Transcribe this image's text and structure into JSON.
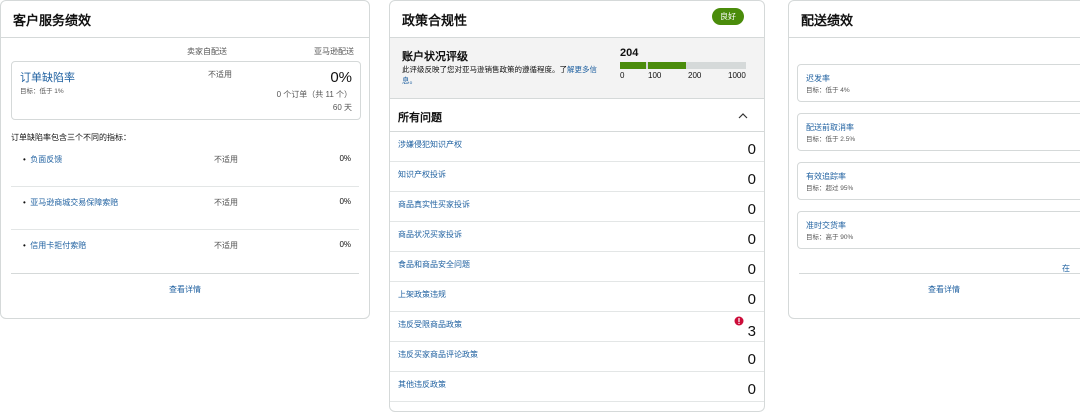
{
  "customer": {
    "title": "客户服务绩效",
    "col_seller": "卖家自配送",
    "col_amazon": "亚马逊配送",
    "odr_label": "订单缺陷率",
    "odr_target": "目标：低于 1%",
    "odr_seller": "不适用",
    "odr_amazon": "0%",
    "odr_orders": "0 个订单（共 11 个）",
    "odr_days": "60 天",
    "intro": "订单缺陷率包含三个不同的指标：",
    "metrics": [
      {
        "label": "负面反馈",
        "seller": "不适用",
        "amazon": "0%"
      },
      {
        "label": "亚马逊商城交易保障索赔",
        "seller": "不适用",
        "amazon": "0%"
      },
      {
        "label": "信用卡拒付索赔",
        "seller": "不适用",
        "amazon": "0%"
      }
    ],
    "details": "查看详情"
  },
  "policy": {
    "title": "政策合规性",
    "badge": "良好",
    "health_title": "账户状况评级",
    "health_desc_1": "此评级反映了您对亚马逊销售政策的遵循程度。了",
    "health_desc_2": "解更多信息。",
    "score": "204",
    "score_fraction": 0.204,
    "scale": [
      "0",
      "100",
      "200",
      "1000"
    ],
    "issues_title": "所有问题",
    "issues": [
      {
        "label": "涉嫌侵犯知识产权",
        "value": "0"
      },
      {
        "label": "知识产权投诉",
        "value": "0"
      },
      {
        "label": "商品真实性买家投诉",
        "value": "0"
      },
      {
        "label": "商品状况买家投诉",
        "value": "0"
      },
      {
        "label": "食品和商品安全问题",
        "value": "0"
      },
      {
        "label": "上架政策违规",
        "value": "0"
      },
      {
        "label": "违反受限商品政策",
        "value": "3"
      },
      {
        "label": "违反买家商品评论政策",
        "value": "0"
      },
      {
        "label": "其他违反政策",
        "value": "0"
      }
    ],
    "colors": {
      "good": "#4a8c0b",
      "alert": "#cc0c39"
    }
  },
  "shipping": {
    "title": "配送绩效",
    "metrics": [
      {
        "label": "迟发率",
        "target": "目标：低于 4%"
      },
      {
        "label": "配送前取消率",
        "target": "目标：低于 2.5%"
      },
      {
        "label": "有效追踪率",
        "target": "目标：超过 95%"
      },
      {
        "label": "准时交货率",
        "target": "目标：高于 90%"
      }
    ],
    "more_link": "在",
    "details": "查看详情"
  }
}
